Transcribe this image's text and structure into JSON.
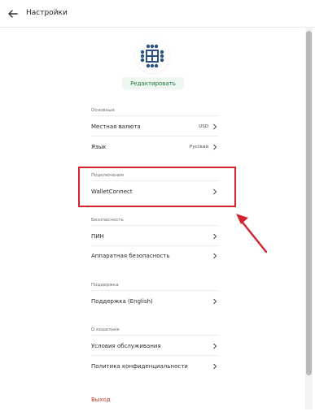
{
  "header": {
    "title": "Настройки",
    "back_icon": "arrow-left-icon"
  },
  "profile": {
    "logo_icon": "wallet-grid-logo-icon",
    "edit_label": "Редактировать",
    "logo_color": "#2c5282"
  },
  "sections": {
    "general": {
      "label": "Основные",
      "items": [
        {
          "label": "Местная валюта",
          "value": "USD"
        },
        {
          "label": "Язык",
          "value": "Русский"
        }
      ]
    },
    "connections": {
      "label": "Подключения",
      "items": [
        {
          "label": "WalletConnect",
          "value": ""
        }
      ]
    },
    "security": {
      "label": "Безопасность",
      "items": [
        {
          "label": "ПИН",
          "value": ""
        },
        {
          "label": "Аппаратная безопасность",
          "value": ""
        }
      ]
    },
    "support": {
      "label": "Поддержка",
      "items": [
        {
          "label": "Поддержка (English)",
          "value": ""
        }
      ]
    },
    "about": {
      "label": "О кошельке",
      "items": [
        {
          "label": "Условия обслуживания",
          "value": ""
        },
        {
          "label": "Политика конфиденциальности",
          "value": ""
        }
      ]
    }
  },
  "logout": {
    "label": "Выход"
  },
  "colors": {
    "accent_green": "#1d7a3e",
    "highlight_red": "#d0242f",
    "logout_red": "#c0392b"
  }
}
